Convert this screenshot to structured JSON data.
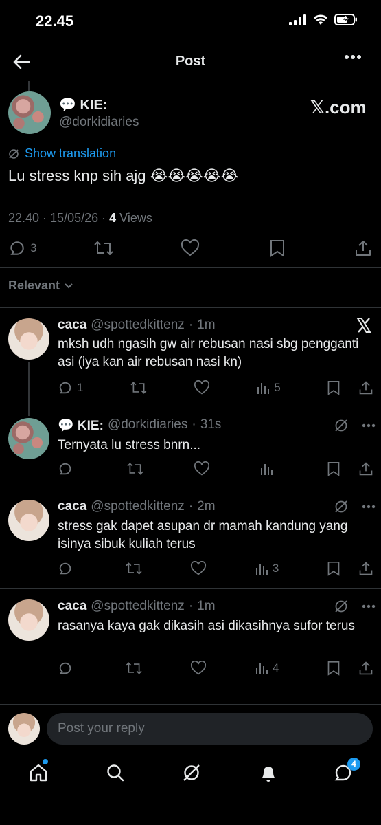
{
  "status_bar": {
    "time": "22.45"
  },
  "header": {
    "title": "Post"
  },
  "main_post": {
    "display_name": "💬 KIE:",
    "handle": "@dorkidiaries",
    "watermark": "𝕏.com",
    "show_translation": "Show translation",
    "text": "Lu stress knp sih ajg 😭😭😭😭😭",
    "time": "22.40",
    "date": "15/05/26",
    "views_count": "4",
    "views_label": "Views",
    "reply_count": "3"
  },
  "sort": {
    "label": "Relevant"
  },
  "replies": [
    {
      "name": "caca",
      "handle": "@spottedkittenz",
      "time": "1m",
      "text": "mksh udh ngasih gw air rebusan nasi sbg pengganti asi (iya kan air rebusan nasi kn)",
      "replies": "1",
      "views": "5"
    },
    {
      "name": "💬 KIE:",
      "handle": "@dorkidiaries",
      "time": "31s",
      "text": "Ternyata lu stress bnrn...",
      "replies": "",
      "views": ""
    },
    {
      "name": "caca",
      "handle": "@spottedkittenz",
      "time": "2m",
      "text": "stress gak dapet asupan dr mamah kandung yang isinya sibuk kuliah terus",
      "replies": "",
      "views": "3"
    },
    {
      "name": "caca",
      "handle": "@spottedkittenz",
      "time": "1m",
      "text": "rasanya kaya gak dikasih asi dikasihnya sufor terus",
      "replies": "",
      "views": "4"
    }
  ],
  "composer": {
    "placeholder": "Post your reply"
  },
  "bottom_nav": {
    "messages_badge": "4"
  },
  "icons": {
    "back": "arrow-left-icon",
    "more": "more-icon",
    "reply": "reply-icon",
    "repost": "repost-icon",
    "like": "heart-icon",
    "views": "views-icon",
    "bookmark": "bookmark-icon",
    "share": "share-icon",
    "grok": "grok-icon",
    "translate": "grok-icon",
    "home": "home-icon",
    "search": "search-icon",
    "notifications": "bell-icon",
    "messages": "chat-icon",
    "x_logo": "x-logo-icon"
  },
  "colors": {
    "background": "#000000",
    "accent": "#1d9bf0",
    "muted": "#71767b",
    "text": "#e7e9ea",
    "divider": "#2f3336"
  }
}
